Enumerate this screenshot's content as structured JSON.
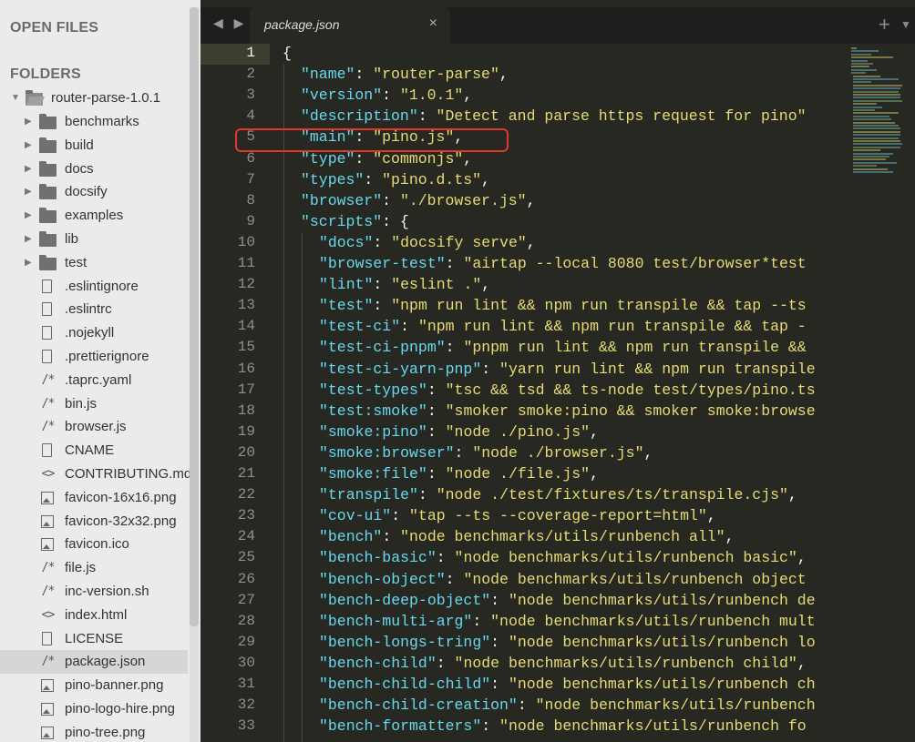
{
  "sidebar": {
    "open_files_label": "OPEN FILES",
    "folders_label": "FOLDERS",
    "root_folder": "router-parse-1.0.1",
    "items": [
      {
        "label": "benchmarks",
        "kind": "folder"
      },
      {
        "label": "build",
        "kind": "folder"
      },
      {
        "label": "docs",
        "kind": "folder"
      },
      {
        "label": "docsify",
        "kind": "folder"
      },
      {
        "label": "examples",
        "kind": "folder"
      },
      {
        "label": "lib",
        "kind": "folder"
      },
      {
        "label": "test",
        "kind": "folder"
      },
      {
        "label": ".eslintignore",
        "kind": "doc"
      },
      {
        "label": ".eslintrc",
        "kind": "doc"
      },
      {
        "label": ".nojekyll",
        "kind": "doc"
      },
      {
        "label": ".prettierignore",
        "kind": "doc"
      },
      {
        "label": ".taprc.yaml",
        "kind": "code",
        "glyph": "/*"
      },
      {
        "label": "bin.js",
        "kind": "code",
        "glyph": "/*"
      },
      {
        "label": "browser.js",
        "kind": "code",
        "glyph": "/*"
      },
      {
        "label": "CNAME",
        "kind": "doc"
      },
      {
        "label": "CONTRIBUTING.md",
        "kind": "code",
        "glyph": "<>"
      },
      {
        "label": "favicon-16x16.png",
        "kind": "image"
      },
      {
        "label": "favicon-32x32.png",
        "kind": "image"
      },
      {
        "label": "favicon.ico",
        "kind": "image"
      },
      {
        "label": "file.js",
        "kind": "code",
        "glyph": "/*"
      },
      {
        "label": "inc-version.sh",
        "kind": "code",
        "glyph": "/*"
      },
      {
        "label": "index.html",
        "kind": "code",
        "glyph": "<>"
      },
      {
        "label": "LICENSE",
        "kind": "doc"
      },
      {
        "label": "package.json",
        "kind": "code",
        "glyph": "/*",
        "selected": true
      },
      {
        "label": "pino-banner.png",
        "kind": "image"
      },
      {
        "label": "pino-logo-hire.png",
        "kind": "image"
      },
      {
        "label": "pino-tree.png",
        "kind": "image"
      }
    ]
  },
  "tabs": {
    "nav_arrows": "◀ ▶",
    "active_tab": "package.json",
    "close_glyph": "×",
    "plus_glyph": "+",
    "dropdown_glyph": "▼"
  },
  "editor": {
    "active_line": 1,
    "lines": [
      {
        "n": "1",
        "parts": [
          [
            "p",
            "{"
          ]
        ]
      },
      {
        "n": "2",
        "indent": 1,
        "parts": [
          [
            "k",
            "\"name\""
          ],
          [
            "p",
            ": "
          ],
          [
            "s",
            "\"router-parse\""
          ],
          [
            "p",
            ","
          ]
        ]
      },
      {
        "n": "3",
        "indent": 1,
        "parts": [
          [
            "k",
            "\"version\""
          ],
          [
            "p",
            ": "
          ],
          [
            "s",
            "\"1.0.1\""
          ],
          [
            "p",
            ","
          ]
        ]
      },
      {
        "n": "4",
        "indent": 1,
        "parts": [
          [
            "k",
            "\"description\""
          ],
          [
            "p",
            ": "
          ],
          [
            "s",
            "\"Detect and parse https request for pino\""
          ]
        ]
      },
      {
        "n": "5",
        "indent": 1,
        "parts": [
          [
            "k",
            "\"main\""
          ],
          [
            "p",
            ": "
          ],
          [
            "s",
            "\"pino.js\""
          ],
          [
            "p",
            ","
          ]
        ]
      },
      {
        "n": "6",
        "indent": 1,
        "parts": [
          [
            "k",
            "\"type\""
          ],
          [
            "p",
            ": "
          ],
          [
            "s",
            "\"commonjs\""
          ],
          [
            "p",
            ","
          ]
        ]
      },
      {
        "n": "7",
        "indent": 1,
        "parts": [
          [
            "k",
            "\"types\""
          ],
          [
            "p",
            ": "
          ],
          [
            "s",
            "\"pino.d.ts\""
          ],
          [
            "p",
            ","
          ]
        ]
      },
      {
        "n": "8",
        "indent": 1,
        "parts": [
          [
            "k",
            "\"browser\""
          ],
          [
            "p",
            ": "
          ],
          [
            "s",
            "\"./browser.js\""
          ],
          [
            "p",
            ","
          ]
        ]
      },
      {
        "n": "9",
        "indent": 1,
        "parts": [
          [
            "k",
            "\"scripts\""
          ],
          [
            "p",
            ": {"
          ]
        ]
      },
      {
        "n": "10",
        "indent": 2,
        "parts": [
          [
            "k",
            "\"docs\""
          ],
          [
            "p",
            ": "
          ],
          [
            "s",
            "\"docsify serve\""
          ],
          [
            "p",
            ","
          ]
        ]
      },
      {
        "n": "11",
        "indent": 2,
        "parts": [
          [
            "k",
            "\"browser-test\""
          ],
          [
            "p",
            ": "
          ],
          [
            "s",
            "\"airtap --local 8080 test/browser*test"
          ]
        ]
      },
      {
        "n": "12",
        "indent": 2,
        "parts": [
          [
            "k",
            "\"lint\""
          ],
          [
            "p",
            ": "
          ],
          [
            "s",
            "\"eslint .\""
          ],
          [
            "p",
            ","
          ]
        ]
      },
      {
        "n": "13",
        "indent": 2,
        "parts": [
          [
            "k",
            "\"test\""
          ],
          [
            "p",
            ": "
          ],
          [
            "s",
            "\"npm run lint && npm run transpile && tap --ts"
          ]
        ]
      },
      {
        "n": "14",
        "indent": 2,
        "parts": [
          [
            "k",
            "\"test-ci\""
          ],
          [
            "p",
            ": "
          ],
          [
            "s",
            "\"npm run lint && npm run transpile && tap -"
          ]
        ]
      },
      {
        "n": "15",
        "indent": 2,
        "parts": [
          [
            "k",
            "\"test-ci-pnpm\""
          ],
          [
            "p",
            ": "
          ],
          [
            "s",
            "\"pnpm run lint && npm run transpile &&"
          ]
        ]
      },
      {
        "n": "16",
        "indent": 2,
        "parts": [
          [
            "k",
            "\"test-ci-yarn-pnp\""
          ],
          [
            "p",
            ": "
          ],
          [
            "s",
            "\"yarn run lint && npm run transpile"
          ]
        ]
      },
      {
        "n": "17",
        "indent": 2,
        "parts": [
          [
            "k",
            "\"test-types\""
          ],
          [
            "p",
            ": "
          ],
          [
            "s",
            "\"tsc && tsd && ts-node test/types/pino.ts"
          ]
        ]
      },
      {
        "n": "18",
        "indent": 2,
        "parts": [
          [
            "k",
            "\"test:smoke\""
          ],
          [
            "p",
            ": "
          ],
          [
            "s",
            "\"smoker smoke:pino && smoker smoke:browse"
          ]
        ]
      },
      {
        "n": "19",
        "indent": 2,
        "parts": [
          [
            "k",
            "\"smoke:pino\""
          ],
          [
            "p",
            ": "
          ],
          [
            "s",
            "\"node ./pino.js\""
          ],
          [
            "p",
            ","
          ]
        ]
      },
      {
        "n": "20",
        "indent": 2,
        "parts": [
          [
            "k",
            "\"smoke:browser\""
          ],
          [
            "p",
            ": "
          ],
          [
            "s",
            "\"node ./browser.js\""
          ],
          [
            "p",
            ","
          ]
        ]
      },
      {
        "n": "21",
        "indent": 2,
        "parts": [
          [
            "k",
            "\"smoke:file\""
          ],
          [
            "p",
            ": "
          ],
          [
            "s",
            "\"node ./file.js\""
          ],
          [
            "p",
            ","
          ]
        ]
      },
      {
        "n": "22",
        "indent": 2,
        "parts": [
          [
            "k",
            "\"transpile\""
          ],
          [
            "p",
            ": "
          ],
          [
            "s",
            "\"node ./test/fixtures/ts/transpile.cjs\""
          ],
          [
            "p",
            ","
          ]
        ]
      },
      {
        "n": "23",
        "indent": 2,
        "parts": [
          [
            "k",
            "\"cov-ui\""
          ],
          [
            "p",
            ": "
          ],
          [
            "s",
            "\"tap --ts --coverage-report=html\""
          ],
          [
            "p",
            ","
          ]
        ]
      },
      {
        "n": "24",
        "indent": 2,
        "parts": [
          [
            "k",
            "\"bench\""
          ],
          [
            "p",
            ": "
          ],
          [
            "s",
            "\"node benchmarks/utils/runbench all\""
          ],
          [
            "p",
            ","
          ]
        ]
      },
      {
        "n": "25",
        "indent": 2,
        "parts": [
          [
            "k",
            "\"bench-basic\""
          ],
          [
            "p",
            ": "
          ],
          [
            "s",
            "\"node benchmarks/utils/runbench basic\""
          ],
          [
            "p",
            ","
          ]
        ]
      },
      {
        "n": "26",
        "indent": 2,
        "parts": [
          [
            "k",
            "\"bench-object\""
          ],
          [
            "p",
            ": "
          ],
          [
            "s",
            "\"node benchmarks/utils/runbench object"
          ]
        ]
      },
      {
        "n": "27",
        "indent": 2,
        "parts": [
          [
            "k",
            "\"bench-deep-object\""
          ],
          [
            "p",
            ": "
          ],
          [
            "s",
            "\"node benchmarks/utils/runbench de"
          ]
        ]
      },
      {
        "n": "28",
        "indent": 2,
        "parts": [
          [
            "k",
            "\"bench-multi-arg\""
          ],
          [
            "p",
            ": "
          ],
          [
            "s",
            "\"node benchmarks/utils/runbench mult"
          ]
        ]
      },
      {
        "n": "29",
        "indent": 2,
        "parts": [
          [
            "k",
            "\"bench-longs-tring\""
          ],
          [
            "p",
            ": "
          ],
          [
            "s",
            "\"node benchmarks/utils/runbench lo"
          ]
        ]
      },
      {
        "n": "30",
        "indent": 2,
        "parts": [
          [
            "k",
            "\"bench-child\""
          ],
          [
            "p",
            ": "
          ],
          [
            "s",
            "\"node benchmarks/utils/runbench child\""
          ],
          [
            "p",
            ","
          ]
        ]
      },
      {
        "n": "31",
        "indent": 2,
        "parts": [
          [
            "k",
            "\"bench-child-child\""
          ],
          [
            "p",
            ": "
          ],
          [
            "s",
            "\"node benchmarks/utils/runbench ch"
          ]
        ]
      },
      {
        "n": "32",
        "indent": 2,
        "parts": [
          [
            "k",
            "\"bench-child-creation\""
          ],
          [
            "p",
            ": "
          ],
          [
            "s",
            "\"node benchmarks/utils/runbench"
          ]
        ]
      },
      {
        "n": "33",
        "indent": 2,
        "parts": [
          [
            "k",
            "\"bench-formatters\""
          ],
          [
            "p",
            ": "
          ],
          [
            "s",
            "\"node benchmarks/utils/runbench fo"
          ]
        ]
      }
    ]
  },
  "colors": {
    "key": "#66d9ef",
    "string": "#e6db74",
    "punct": "#f8f8f2",
    "highlight": "#e2382a"
  }
}
